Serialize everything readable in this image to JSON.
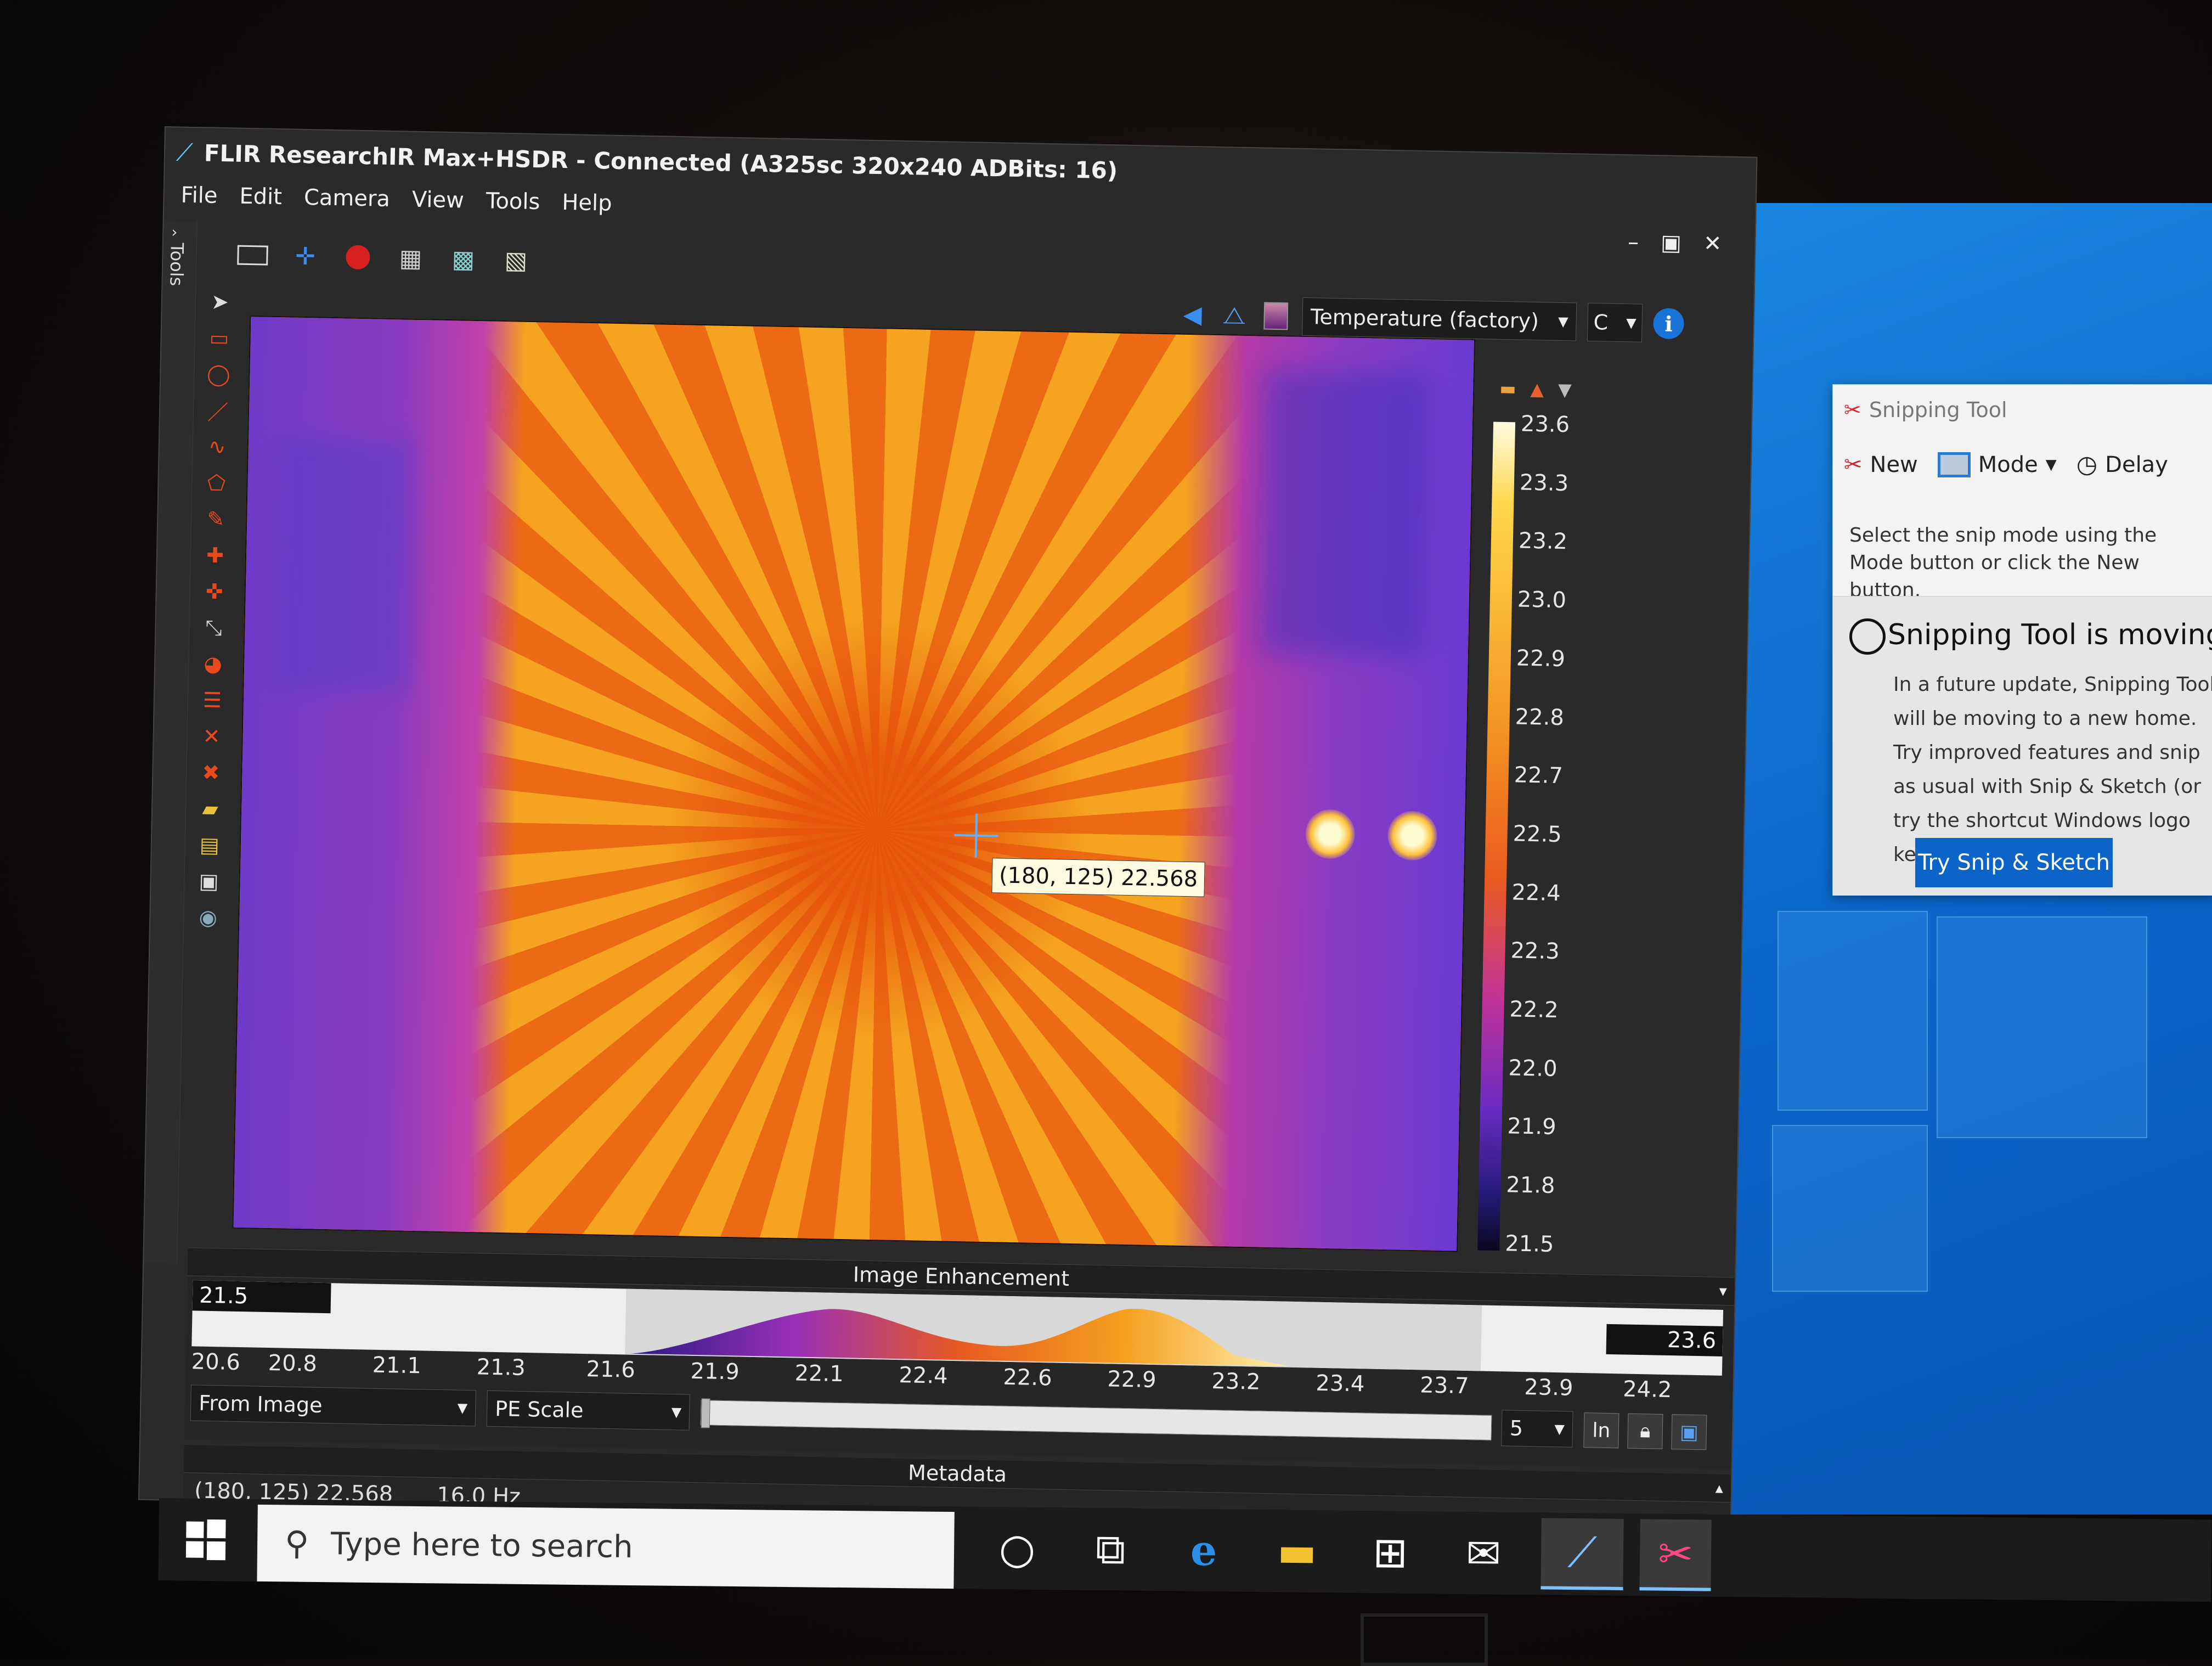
{
  "flir": {
    "title": "FLIR ResearchIR Max+HSDR - Connected (A325sc 320x240 ADBits: 16)",
    "menu": [
      "File",
      "Edit",
      "Camera",
      "View",
      "Tools",
      "Help"
    ],
    "tools_label": "Tools",
    "measurement_dropdown": "Temperature (factory)",
    "unit_dropdown": "C",
    "cursor_readout": "(180, 125) 22.568",
    "color_scale_ticks": [
      "23.6",
      "23.3",
      "23.2",
      "23.0",
      "22.9",
      "22.8",
      "22.7",
      "22.5",
      "22.4",
      "22.3",
      "22.2",
      "22.0",
      "21.9",
      "21.8",
      "21.5"
    ],
    "image_enhancement": {
      "header": "Image Enhancement",
      "low_value": "21.5",
      "high_value": "23.6",
      "axis_ticks": [
        "20.6",
        "20.8",
        "21.1",
        "21.3",
        "21.6",
        "21.9",
        "22.1",
        "22.4",
        "22.6",
        "22.9",
        "23.2",
        "23.4",
        "23.7",
        "23.9",
        "24.2"
      ],
      "source_dropdown": "From Image",
      "scale_dropdown": "PE Scale",
      "spin_value": "5",
      "ln_button": "ln"
    },
    "metadata": {
      "header": "Metadata",
      "position_value": "(180, 125) 22.568",
      "frame_rate": "16.0 Hz"
    }
  },
  "snipping_tool": {
    "title": "Snipping Tool",
    "new_label": "New",
    "mode_label": "Mode",
    "delay_label": "Delay",
    "description": "Select the snip mode using the Mode button or click the New button.",
    "notice_title": "Snipping Tool is moving...",
    "notice_body": "In a future update, Snipping Tool will be moving to a new home. Try improved features and snip as usual with Snip & Sketch (or try the shortcut Windows logo key + Shift + S).",
    "try_button": "Try Snip & Sketch"
  },
  "taskbar": {
    "search_placeholder": "Type here to search",
    "icons": [
      "cortana-icon",
      "task-view-icon",
      "edge-icon",
      "file-explorer-icon",
      "store-icon",
      "mail-icon",
      "researchir-icon",
      "snipping-tool-icon"
    ]
  },
  "colors": {
    "accent": "#0d64c8",
    "desktop": "#0b64c8",
    "window_bg": "#2a2a2a",
    "crosshair": "#5fb0ff"
  }
}
